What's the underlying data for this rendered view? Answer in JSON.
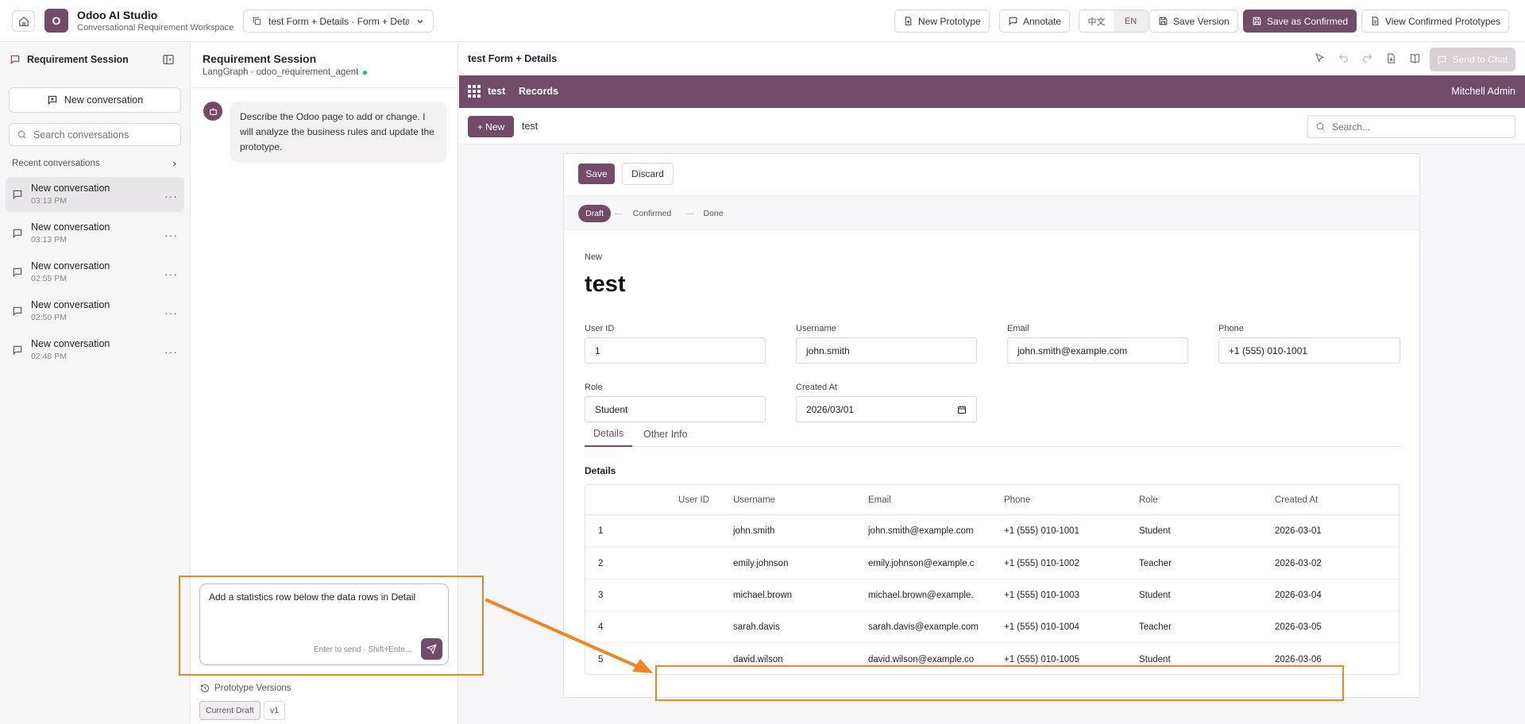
{
  "app": {
    "title": "Odoo AI Studio",
    "subtitle": "Conversational Requirement Workspace",
    "logo_letter": "O",
    "accent_color": "#714b67",
    "annotation_color": "#f18524"
  },
  "topbar": {
    "prototype_select": "test Form + Details · Form + Details",
    "new_prototype": "New Prototype",
    "annotate": "Annotate",
    "lang_zh": "中文",
    "lang_en": "EN",
    "save_version": "Save Version",
    "save_confirmed": "Save as Confirmed",
    "view_confirmed": "View Confirmed Prototypes"
  },
  "sidebar": {
    "title": "Requirement Session",
    "new_conversation": "New conversation",
    "search_placeholder": "Search conversations",
    "recent_label": "Recent conversations",
    "conversations": [
      {
        "title": "New conversation",
        "time": "03:13 PM"
      },
      {
        "title": "New conversation",
        "time": "03:13 PM"
      },
      {
        "title": "New conversation",
        "time": "02:55 PM"
      },
      {
        "title": "New conversation",
        "time": "02:50 PM"
      },
      {
        "title": "New conversation",
        "time": "02:48 PM"
      }
    ]
  },
  "chat": {
    "title": "Requirement Session",
    "subtitle": "LangGraph · odoo_requirement_agent",
    "bot_message": "Describe the Odoo page to add or change. I will analyze the business rules and update the prototype.",
    "composer_text": "Add a statistics row below the data rows in Detail",
    "composer_hint": "Enter to send · Shift+Ente...",
    "versions_title": "Prototype Versions",
    "version_current": "Current Draft",
    "version_v1": "v1"
  },
  "preview": {
    "title": "test Form + Details",
    "send_to_chat": "Send to Chat",
    "nav_app": "test",
    "nav_records": "Records",
    "nav_user": "Mitchell Admin",
    "new_button": "+ New",
    "breadcrumb": "test",
    "search_placeholder": "Search...",
    "save": "Save",
    "discard": "Discard",
    "stages": [
      "Draft",
      "Confirmed",
      "Done"
    ],
    "record_state": "New",
    "record_name": "test",
    "fields": {
      "user_id_label": "User ID",
      "user_id": "1",
      "username_label": "Username",
      "username": "john.smith",
      "email_label": "Email",
      "email": "john.smith@example.com",
      "phone_label": "Phone",
      "phone": "+1 (555) 010-1001",
      "role_label": "Role",
      "role": "Student",
      "created_label": "Created At",
      "created": "2026/03/01"
    },
    "tabs": [
      "Details",
      "Other Info"
    ],
    "section": "Details",
    "table": {
      "columns": [
        "User ID",
        "Username",
        "Email",
        "Phone",
        "Role",
        "Created At"
      ],
      "rows": [
        [
          "1",
          "john.smith",
          "john.smith@example.com",
          "+1 (555) 010-1001",
          "Student",
          "2026-03-01"
        ],
        [
          "2",
          "emily.johnson",
          "emily.johnson@example.c",
          "+1 (555) 010-1002",
          "Teacher",
          "2026-03-02"
        ],
        [
          "3",
          "michael.brown",
          "michael.brown@example.",
          "+1 (555) 010-1003",
          "Student",
          "2026-03-04"
        ],
        [
          "4",
          "sarah.davis",
          "sarah.davis@example.com",
          "+1 (555) 010-1004",
          "Teacher",
          "2026-03-05"
        ],
        [
          "5",
          "david.wilson",
          "david.wilson@example.co",
          "+1 (555) 010-1005",
          "Student",
          "2026-03-06"
        ]
      ]
    }
  }
}
